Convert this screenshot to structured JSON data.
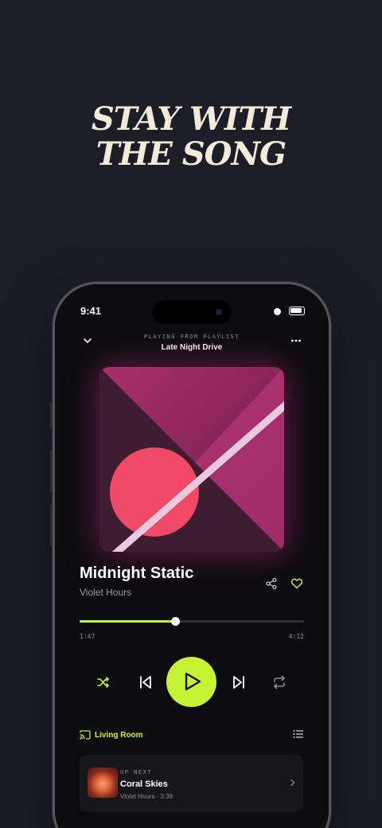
{
  "headline": {
    "line1": "STAY WITH",
    "line2": "THE SONG"
  },
  "status_bar": {
    "time": "9:41"
  },
  "now_playing": {
    "kicker": "PLAYING FROM PLAYLIST",
    "playlist": "Late Night Drive",
    "track_title": "Midnight Static",
    "artist": "Violet Hours",
    "elapsed": "1:47",
    "duration": "4:12",
    "progress": 0.425,
    "liked": true
  },
  "icons": {
    "collapse": "chevron-down-icon",
    "more": "more-horizontal-icon",
    "share": "share-icon",
    "like": "heart-icon",
    "shuffle": "shuffle-icon",
    "previous": "skip-back-icon",
    "play": "play-icon",
    "next": "skip-forward-icon",
    "repeat": "repeat-icon",
    "cast": "cast-icon",
    "queue": "queue-list-icon",
    "next_chevron": "chevron-right-icon"
  },
  "output_device": {
    "label": "Living Room"
  },
  "up_next": {
    "kicker": "UP NEXT",
    "title": "Coral Skies",
    "meta": "Violet Hours · 3:38"
  },
  "colors": {
    "accent": "#c6f432",
    "background": "#1c1d27",
    "headline": "#f3ead8",
    "art_glow": "#c8288a"
  }
}
